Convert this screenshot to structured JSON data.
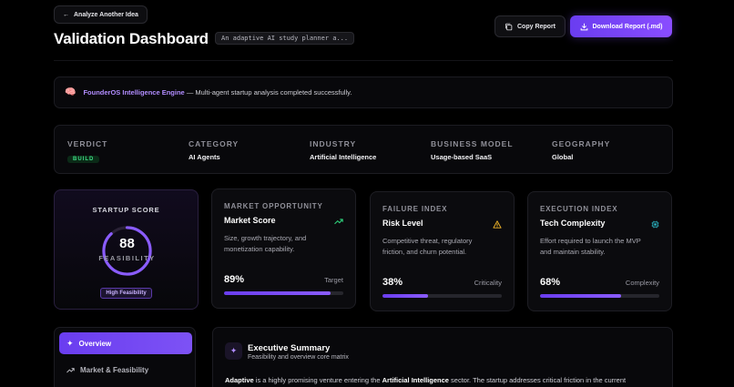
{
  "header": {
    "back_label": "Analyze Another Idea",
    "title": "Validation Dashboard",
    "idea_chip": "An adaptive AI study planner a...",
    "copy_label": "Copy Report",
    "download_label": "Download Report (.md)"
  },
  "banner": {
    "brand": "FounderOS Intelligence Engine",
    "message": "— Multi-agent startup analysis completed successfully."
  },
  "meta": {
    "verdict_label": "VERDICT",
    "verdict_value": "BUILD",
    "category_label": "CATEGORY",
    "category_value": "AI Agents",
    "industry_label": "INDUSTRY",
    "industry_value": "Artificial Intelligence",
    "model_label": "BUSINESS MODEL",
    "model_value": "Usage-based SaaS",
    "geo_label": "GEOGRAPHY",
    "geo_value": "Global"
  },
  "score": {
    "label": "STARTUP SCORE",
    "value": 88,
    "value_text": "88",
    "sub": "FEASIBILITY",
    "badge": "High Feasibility"
  },
  "metrics": [
    {
      "kicker": "MARKET OPPORTUNITY",
      "title": "Market Score",
      "desc": "Size, growth trajectory, and monetization capability.",
      "pct": 89,
      "pct_text": "89%",
      "tag": "Target",
      "icon": "trend-up-icon",
      "icon_color": "#2ecf7a"
    },
    {
      "kicker": "FAILURE INDEX",
      "title": "Risk Level",
      "desc": "Competitive threat, regulatory friction, and churn potential.",
      "pct": 38,
      "pct_text": "38%",
      "tag": "Criticality",
      "icon": "warning-icon",
      "icon_color": "#f0b429"
    },
    {
      "kicker": "EXECUTION INDEX",
      "title": "Tech Complexity",
      "desc": "Effort required to launch the MVP and maintain stability.",
      "pct": 68,
      "pct_text": "68%",
      "tag": "Complexity",
      "icon": "chip-icon",
      "icon_color": "#2ec8d8"
    }
  ],
  "nav": {
    "overview": "Overview",
    "market": "Market & Feasibility"
  },
  "summary": {
    "title": "Executive Summary",
    "subtitle": "Feasibility and overview core matrix",
    "body_name": "Adaptive",
    "body_mid": " is a highly promising venture entering the ",
    "body_sector": "Artificial Intelligence",
    "body_end": " sector. The startup addresses critical friction in the current"
  },
  "colors": {
    "accent": "#7b4dff",
    "verdict": "#3ddc84",
    "brand_text": "#b18cff"
  }
}
